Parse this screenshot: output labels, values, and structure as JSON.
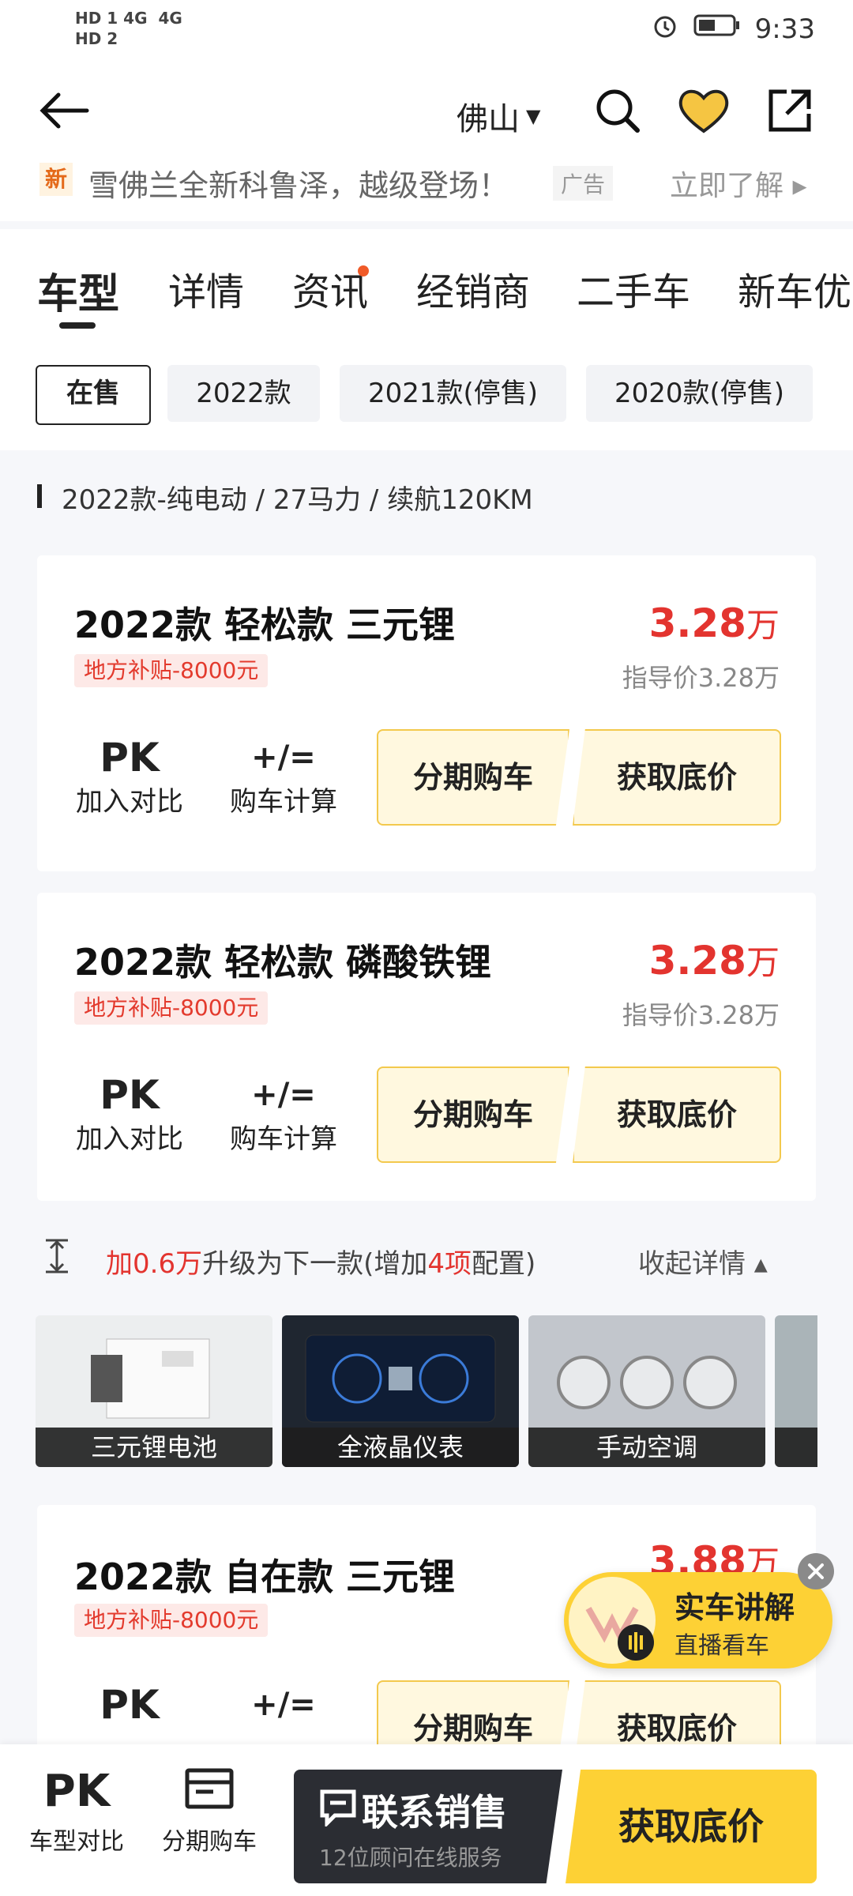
{
  "status": {
    "left_signal": "HD 1 4G  4G\nHD 2",
    "time": "9:33"
  },
  "topbar": {
    "city": "佛山"
  },
  "ad": {
    "badge": "新",
    "text": "雪佛兰全新科鲁泽，越级登场！",
    "tag": "广告",
    "cta": "立即了解 ▸"
  },
  "tabs": [
    {
      "label": "车型"
    },
    {
      "label": "详情"
    },
    {
      "label": "资讯"
    },
    {
      "label": "经销商"
    },
    {
      "label": "二手车"
    },
    {
      "label": "新车优"
    }
  ],
  "chips": [
    {
      "label": "在售"
    },
    {
      "label": "2022款"
    },
    {
      "label": "2021款(停售)"
    },
    {
      "label": "2020款(停售)"
    }
  ],
  "section_header": "2022款-纯电动 / 27马力 / 续航120KM",
  "cards": [
    {
      "title": "2022款 轻松款 三元锂",
      "subsidy": "地方补贴-8000元",
      "price": "3.28",
      "unit": "万",
      "guide": "指导价3.28万"
    },
    {
      "title": "2022款 轻松款 磷酸铁锂",
      "subsidy": "地方补贴-8000元",
      "price": "3.28",
      "unit": "万",
      "guide": "指导价3.28万"
    },
    {
      "title": "2022款 自在款 三元锂",
      "subsidy": "地方补贴-8000元",
      "price": "3.88",
      "unit": "万",
      "guide": ""
    }
  ],
  "tools": {
    "pk": "PK",
    "pk_label": "加入对比",
    "calc_symbol": "+/=",
    "calc_label": "购车计算",
    "installment": "分期购车",
    "lowest": "获取底价"
  },
  "upgrade": {
    "prefix": "加",
    "amount": "0.6万",
    "mid": "升级为下一款(增加",
    "count": "4项",
    "suffix": "配置)",
    "collapse": "收起详情 ▴"
  },
  "features": [
    {
      "label": "三元锂电池"
    },
    {
      "label": "全液晶仪表"
    },
    {
      "label": "手动空调"
    }
  ],
  "live": {
    "title": "实车讲解",
    "subtitle": "直播看车"
  },
  "bottom": {
    "compare_icon": "PK",
    "compare": "车型对比",
    "installment": "分期购车",
    "contact": "联系销售",
    "contact_sub": "12位顾问在线服务",
    "lowest": "获取底价"
  },
  "colors": {
    "accent_red": "#e3342f",
    "yellow": "#fdd135",
    "dark": "#2b2d33"
  }
}
